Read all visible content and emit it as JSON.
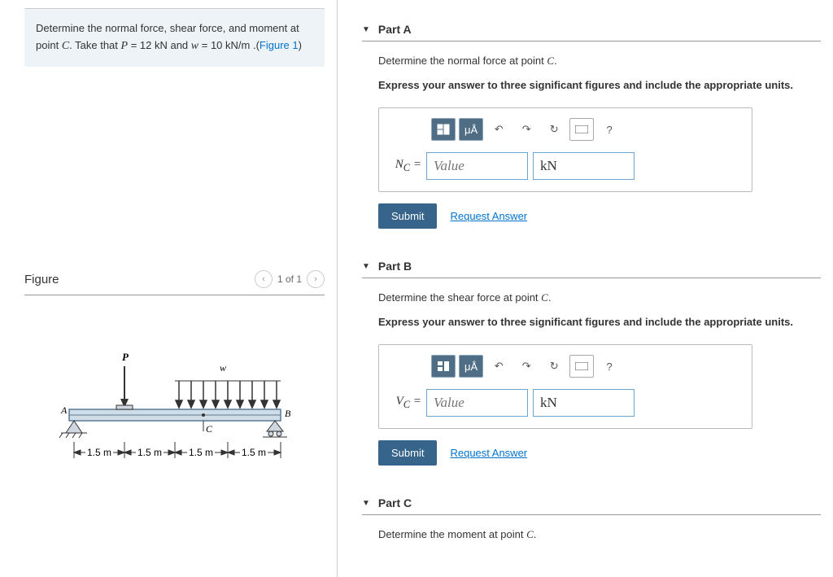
{
  "problem": {
    "text_start": "Determine the normal force, shear force, and moment at point ",
    "point": "C",
    "text_mid": ". Take that ",
    "P_var": "P",
    "P_eq": " = 12 kN",
    "and": " and ",
    "w_var": "w",
    "w_eq": " = 10 ",
    "w_unit": "kN/m",
    "text_end": " .(",
    "figure_link": "Figure 1",
    "paren_close": ")"
  },
  "figure": {
    "title": "Figure",
    "pager": "1 of 1",
    "labels": {
      "P": "P",
      "w": "w",
      "A": "A",
      "B": "B",
      "C": "C",
      "d": "1.5 m"
    }
  },
  "parts": {
    "A": {
      "header": "Part A",
      "prompt_start": "Determine the normal force at point ",
      "prompt_var": "C",
      "prompt_end": ".",
      "instr": "Express your answer to three significant figures and include the appropriate units.",
      "label_var": "N",
      "label_sub": "C",
      "label_eq": " =",
      "value_placeholder": "Value",
      "unit_value": "kN",
      "submit": "Submit",
      "request": "Request Answer"
    },
    "B": {
      "header": "Part B",
      "prompt_start": "Determine the shear force at point ",
      "prompt_var": "C",
      "prompt_end": ".",
      "instr": "Express your answer to three significant figures and include the appropriate units.",
      "label_var": "V",
      "label_sub": "C",
      "label_eq": " =",
      "value_placeholder": "Value",
      "unit_value": "kN",
      "submit": "Submit",
      "request": "Request Answer"
    },
    "C": {
      "header": "Part C",
      "prompt_start": "Determine the moment at point ",
      "prompt_var": "C",
      "prompt_end": "."
    }
  },
  "toolbar": {
    "units_icon": "μÅ",
    "help": "?"
  }
}
